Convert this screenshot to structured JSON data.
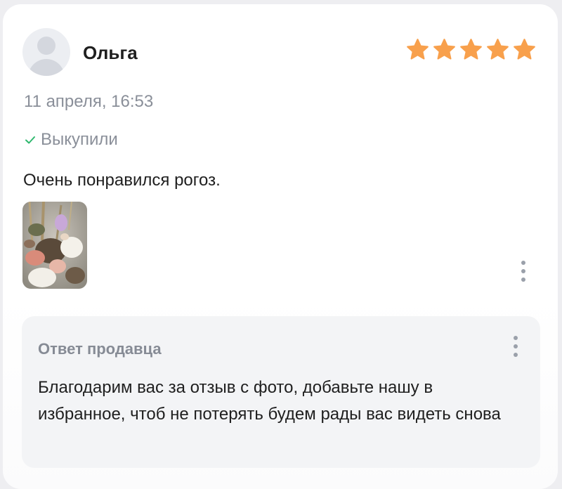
{
  "review": {
    "author": "Ольга",
    "rating": 5,
    "rating_max": 5,
    "date": "11 апреля, 16:53",
    "purchase_status": "Выкупили",
    "text": "Очень понравился рогоз.",
    "photos_count": 1
  },
  "seller_reply": {
    "title": "Ответ продавца",
    "text": "Благодарим вас за отзыв с фото, добавьте нашу в избранное, чтоб не потерять будем рады вас видеть снова"
  },
  "icons": {
    "avatar": "user-avatar-placeholder",
    "star": "star-icon",
    "check": "check-icon",
    "more": "more-vertical-icon"
  },
  "colors": {
    "star": "#f8a04c",
    "check": "#2fb86e",
    "muted_text": "#8a8f99",
    "reply_background": "#f3f4f6"
  }
}
